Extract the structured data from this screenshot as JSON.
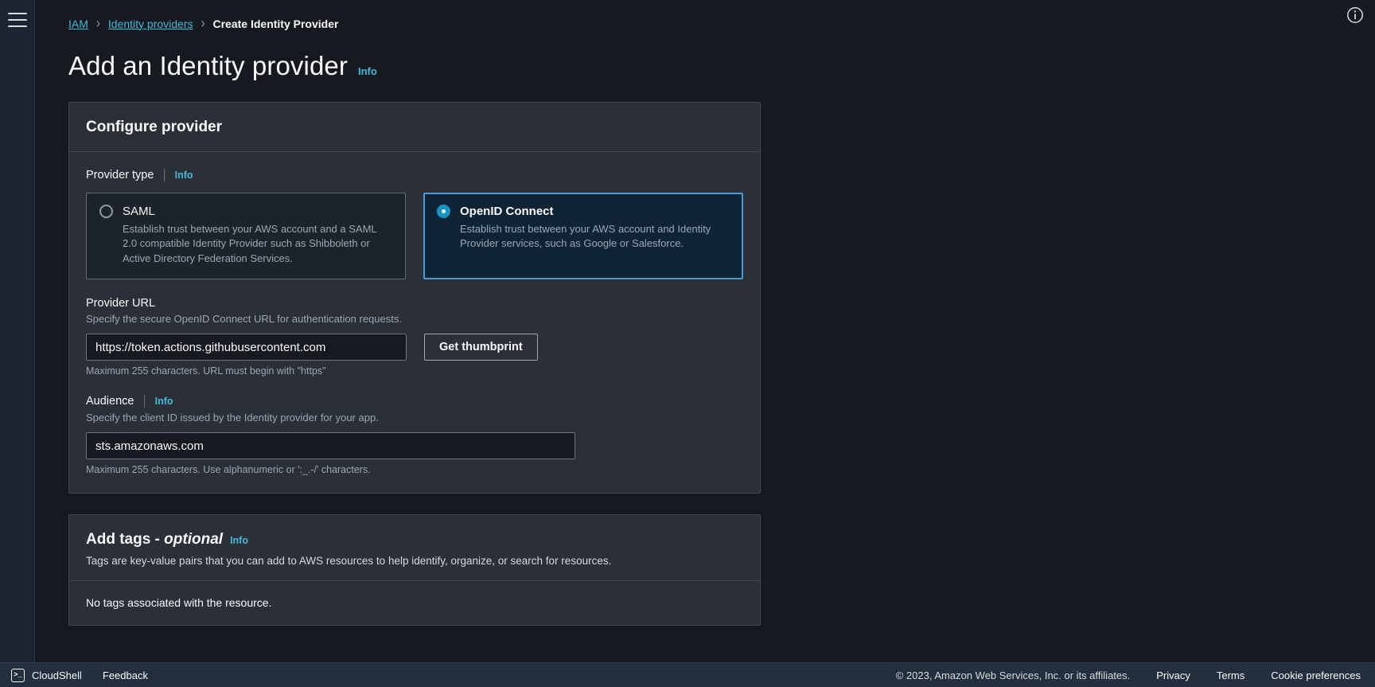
{
  "left_rail": {
    "menu_icon": "hamburger-menu-icon"
  },
  "top_right": {
    "info_icon": "info-circle-icon"
  },
  "breadcrumb": {
    "items": [
      {
        "label": "IAM",
        "current": false
      },
      {
        "label": "Identity providers",
        "current": false
      },
      {
        "label": "Create Identity Provider",
        "current": true
      }
    ],
    "separator": "›"
  },
  "page": {
    "title": "Add an Identity provider",
    "info_label": "Info"
  },
  "configure_card": {
    "title": "Configure provider",
    "provider_type": {
      "label": "Provider type",
      "info_label": "Info",
      "options": [
        {
          "id": "saml",
          "label": "SAML",
          "description": "Establish trust between your AWS account and a SAML 2.0 compatible Identity Provider such as Shibboleth or Active Directory Federation Services.",
          "selected": false
        },
        {
          "id": "oidc",
          "label": "OpenID Connect",
          "description": "Establish trust between your AWS account and Identity Provider services, such as Google or Salesforce.",
          "selected": true
        }
      ]
    },
    "provider_url": {
      "label": "Provider URL",
      "description": "Specify the secure OpenID Connect URL for authentication requests.",
      "value": "https://token.actions.githubusercontent.com",
      "placeholder": "https://",
      "hint": "Maximum 255 characters. URL must begin with \"https\"",
      "button_label": "Get thumbprint"
    },
    "audience": {
      "label": "Audience",
      "info_label": "Info",
      "description": "Specify the client ID issued by the Identity provider for your app.",
      "value": "sts.amazonaws.com",
      "placeholder": "",
      "hint": "Maximum 255 characters. Use alphanumeric or ':_.-/' characters."
    }
  },
  "tags_card": {
    "title_main": "Add tags - ",
    "title_optional": "optional",
    "info_label": "Info",
    "description": "Tags are key-value pairs that you can add to AWS resources to help identify, organize, or search for resources.",
    "empty_text": "No tags associated with the resource."
  },
  "footer": {
    "cloudshell_label": "CloudShell",
    "cloudshell_icon": ">_",
    "feedback_label": "Feedback",
    "copyright": "© 2023, Amazon Web Services, Inc. or its affiliates.",
    "privacy_label": "Privacy",
    "terms_label": "Terms",
    "cookie_label": "Cookie preferences"
  },
  "colors": {
    "accent_link": "#44b9d6",
    "selected_border": "#4a9ad4",
    "selected_fill": "#0e2435",
    "radio_on": "#1495c4",
    "page_bg": "#16191f",
    "card_bg": "#2a2f38",
    "footer_bg": "#232f3e"
  }
}
